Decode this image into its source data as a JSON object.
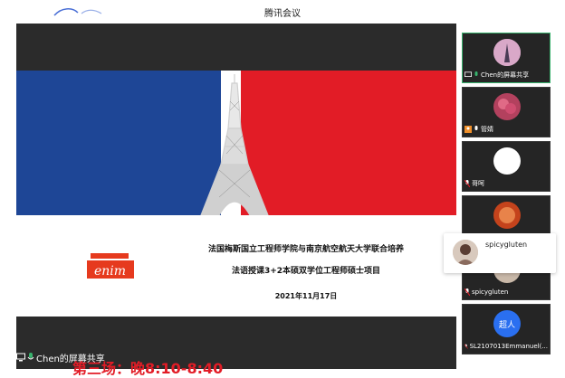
{
  "window": {
    "title": "腾讯会议"
  },
  "slide": {
    "line1": "法国梅斯国立工程师学院与南京航空航天大学联合培养",
    "line2": "法语授课3+2本硕双学位工程师硕士项目",
    "date": "2021年11月17日",
    "logo_text": "enim"
  },
  "main": {
    "screen_share_label": "Chen的屏幕共享",
    "footer_text": "第三场：晚8:10-8:40"
  },
  "participants": [
    {
      "name": "Chen的屏幕共享",
      "avatar": "eiffel-tower-avatar",
      "active": true
    },
    {
      "name": "管婧",
      "avatar": "flower-avatar",
      "active": false
    },
    {
      "name": "哥呵",
      "avatar": "white-circle-avatar",
      "active": false
    },
    {
      "name": "",
      "avatar": "food-avatar",
      "active": false
    },
    {
      "name": "spicygluten",
      "avatar": "person-avatar",
      "active": false
    },
    {
      "name": "SL2107013Emmanuel(...",
      "avatar": "text-avatar",
      "avatar_text": "超人",
      "active": false
    }
  ],
  "popup": {
    "name": "spicygluten"
  },
  "colors": {
    "flag_blue": "#1e4696",
    "flag_red": "#e21c26",
    "active_border": "#38b26d",
    "avatar_blue": "#2a6ff0"
  }
}
